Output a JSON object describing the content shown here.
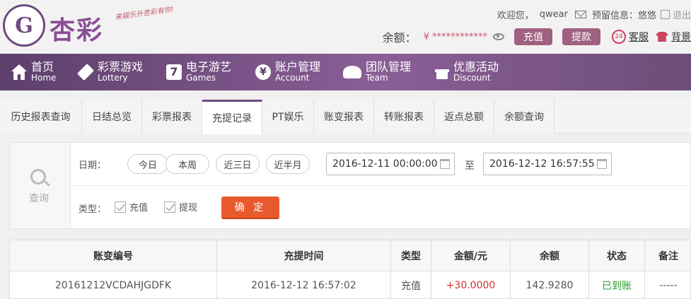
{
  "header": {
    "logo_glyph": "G",
    "brand": "杏彩",
    "slogan": "来娱乐升杏彩有你!",
    "welcome": "欢迎您，",
    "username": "qwear",
    "preset_info_label": "预留信息：",
    "preset_info_value": "悠悠",
    "logout": "退出",
    "balance_label": "余额：",
    "balance_mask": "¥ ************",
    "recharge_btn": "充值",
    "withdraw_btn": "提款",
    "service_badge": "24",
    "service_label": "客服",
    "skin_label": "背景"
  },
  "nav": [
    {
      "cn": "首页",
      "en": "Home",
      "icon": "home-icon"
    },
    {
      "cn": "彩票游戏",
      "en": "Lottery",
      "icon": "ticket-icon"
    },
    {
      "cn": "电子游艺",
      "en": "Games",
      "icon": "seven-icon",
      "glyph": "7"
    },
    {
      "cn": "账户管理",
      "en": "Account",
      "icon": "yen-coin-icon",
      "glyph": "¥"
    },
    {
      "cn": "团队管理",
      "en": "Team",
      "icon": "team-icon"
    },
    {
      "cn": "优惠活动",
      "en": "Discount",
      "icon": "gift-icon"
    }
  ],
  "tabs": [
    "历史报表查询",
    "日结总览",
    "彩票报表",
    "充提记录",
    "PT娱乐",
    "账变报表",
    "转账报表",
    "返点总额",
    "余额查询"
  ],
  "active_tab": "充提记录",
  "filter": {
    "search_label": "查询",
    "date_label": "日期：",
    "quick": [
      "今日",
      "本周",
      "近三日",
      "近半月"
    ],
    "start": "2016-12-11 00:00:00",
    "to_label": "至",
    "end": "2016-12-12 16:57:55",
    "type_label": "类型：",
    "types": [
      "充值",
      "提现"
    ],
    "confirm": "确 定"
  },
  "table": {
    "headers": [
      "账变编号",
      "充提时间",
      "类型",
      "金额/元",
      "余额",
      "状态",
      "备注"
    ],
    "rows": [
      [
        "20161212VCDAHJGDFK",
        "2016-12-12 16:57:02",
        "充值",
        "+30.0000",
        "142.9280",
        "已到账",
        "-----"
      ]
    ]
  },
  "colors": {
    "brand_purple": "#6e4a7e",
    "confirm_orange": "#e85a2e",
    "amount_red": "#d03030",
    "status_green": "#2a9a2a"
  }
}
